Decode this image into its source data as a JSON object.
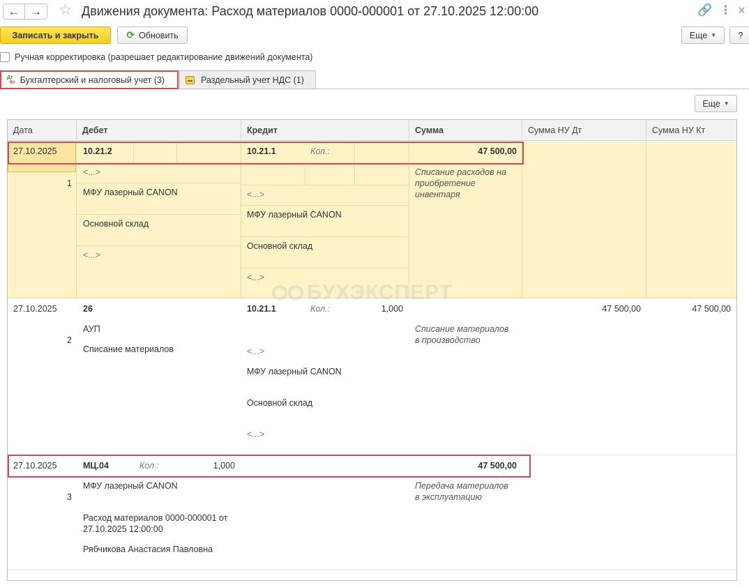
{
  "window": {
    "title": "Движения документа: Расход материалов 0000-000001 от 27.10.2025 12:00:00"
  },
  "toolbar": {
    "save_close": "Записать и закрыть",
    "refresh": "Обновить",
    "more": "Еще",
    "help": "?"
  },
  "manual_correction": {
    "label": "Ручная корректировка (разрешает редактирование движений документа)",
    "checked": false
  },
  "tabs": [
    {
      "label": "Бухгалтерский и налоговый учет (3)",
      "active": true
    },
    {
      "label": "Раздельный учет НДС (1)",
      "active": false
    }
  ],
  "tab_icon": {
    "dt": "Дт",
    "kt": "Кт"
  },
  "grid_toolbar": {
    "more": "Еще"
  },
  "columns": {
    "date": "Дата",
    "debit": "Дебет",
    "credit": "Кредит",
    "sum": "Сумма",
    "sum_nu_dt": "Сумма НУ Дт",
    "sum_nu_kt": "Сумма НУ Кт"
  },
  "rows": [
    {
      "date": "27.10.2025",
      "num": "1",
      "debit_account": "10.21.2",
      "debit_sub1": "<...>",
      "debit_sub2": "МФУ лазерный CANON",
      "debit_sub3": "Основной склад",
      "debit_sub4": "<...>",
      "credit_account": "10.21.1",
      "credit_qty_label": "Кол.:",
      "credit_sub1": "<...>",
      "credit_sub2": "МФУ лазерный CANON",
      "credit_sub3": "Основной склад",
      "credit_sub4": "<...>",
      "sum": "47 500,00",
      "content_line1": "Списание расходов на",
      "content_line2": "приобретение",
      "content_line3": "инвентаря"
    },
    {
      "date": "27.10.2025",
      "num": "2",
      "debit_account": "26",
      "debit_sub1": "АУП",
      "debit_sub2": "Списание материалов",
      "credit_account": "10.21.1",
      "credit_qty_label": "Кол.:",
      "credit_qty": "1,000",
      "credit_sub1": "<...>",
      "credit_sub2": "МФУ лазерный CANON",
      "credit_sub3": "Основной склад",
      "credit_sub4": "<...>",
      "sum_nu_dt": "47 500,00",
      "sum_nu_kt": "47 500,00",
      "content_line1": "Списание материалов",
      "content_line2": "в производство"
    },
    {
      "date": "27.10.2025",
      "num": "3",
      "debit_account": "МЦ.04",
      "debit_qty_label": "Кол.:",
      "debit_qty": "1,000",
      "debit_sub1": "МФУ лазерный CANON",
      "debit_sub2_line1": "Расход материалов 0000-000001 от",
      "debit_sub2_line2": "27.10.2025 12:00:00",
      "debit_sub3": "Рябчикова Анастасия Павловна",
      "sum": "47 500,00",
      "content_line1": "Передача материалов",
      "content_line2": "в эксплуатацию"
    }
  ],
  "watermark": "БУХЭКСПЕРТ"
}
